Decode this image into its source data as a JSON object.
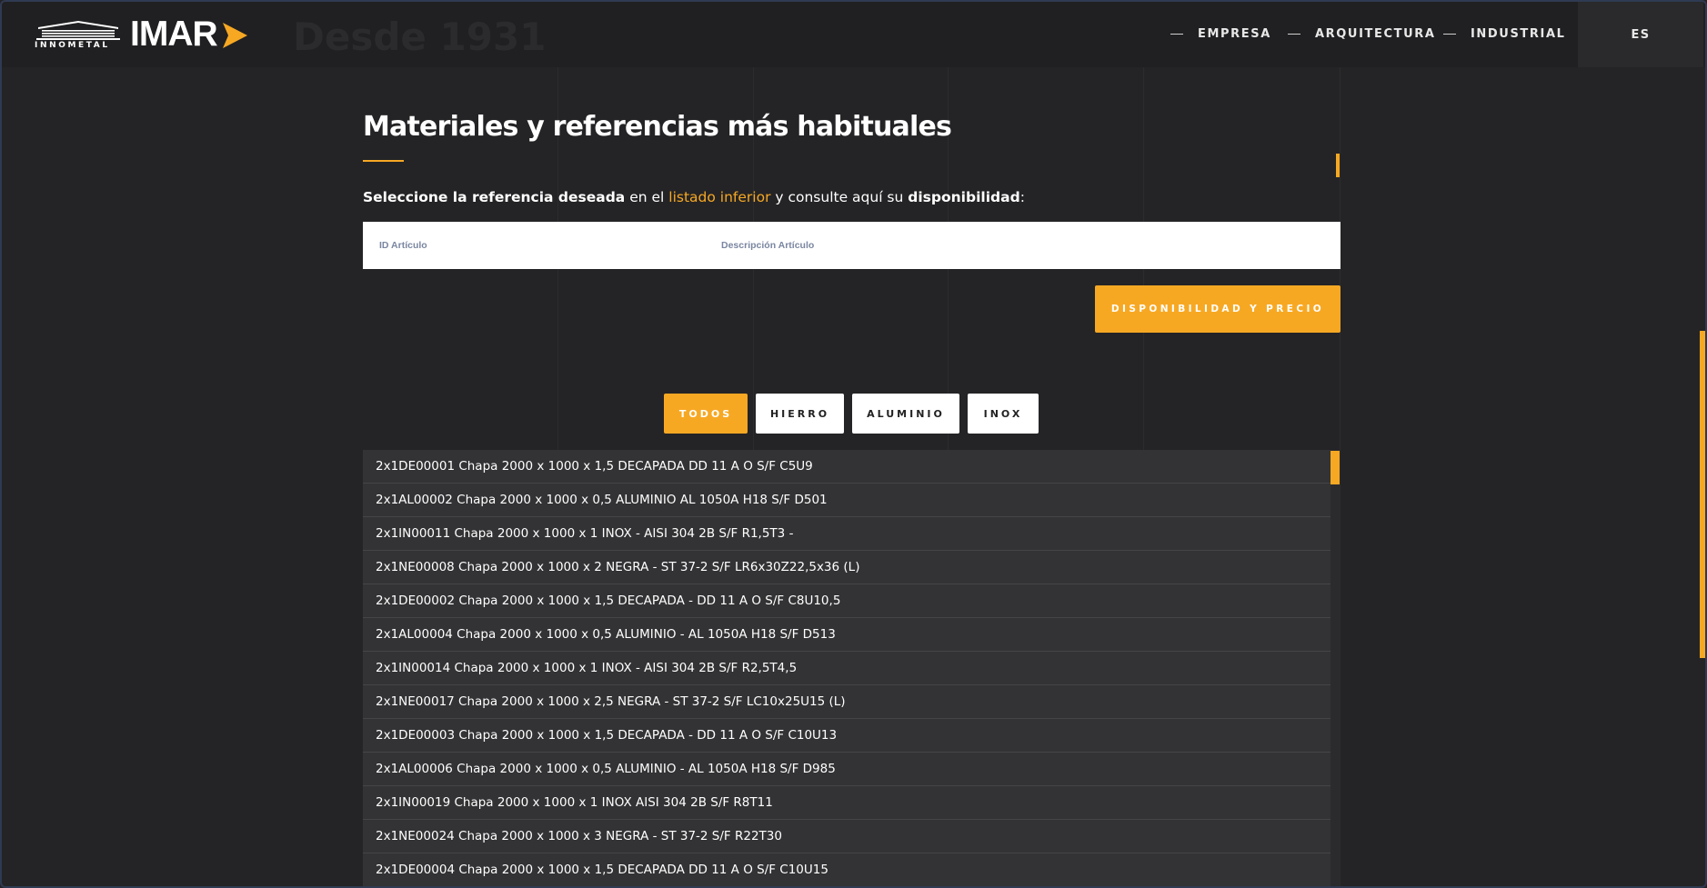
{
  "header": {
    "logo_innometal": "INNOMETAL",
    "logo_imar": "IMAR",
    "since": "Desde 1931",
    "nav": [
      {
        "label": "EMPRESA"
      },
      {
        "label": "ARQUITECTURA"
      },
      {
        "label": "INDUSTRIAL"
      }
    ],
    "language": "ES"
  },
  "main": {
    "title": "Materiales y referencias más habituales",
    "instruction": {
      "part1": "Seleccione la referencia deseada",
      "part2": " en el ",
      "part3": "listado inferior",
      "part4": " y consulte aquí su ",
      "part5": "disponibilidad",
      "part6": ":"
    },
    "search": {
      "id_placeholder": "ID Artículo",
      "desc_placeholder": "Descripción Artículo"
    },
    "price_button": "DISPONIBILIDAD Y PRECIO",
    "filters": [
      {
        "label": "TODOS",
        "active": true
      },
      {
        "label": "HIERRO",
        "active": false
      },
      {
        "label": "ALUMINIO",
        "active": false
      },
      {
        "label": "INOX",
        "active": false
      }
    ],
    "items": [
      "2x1DE00001 Chapa 2000 x 1000 x 1,5 DECAPADA DD 11 A O S/F C5U9",
      "2x1AL00002 Chapa 2000 x 1000 x 0,5 ALUMINIO AL 1050A H18 S/F D501",
      "2x1IN00011 Chapa 2000 x 1000 x 1 INOX - AISI 304 2B S/F R1,5T3 -",
      "2x1NE00008 Chapa 2000 x 1000 x 2 NEGRA - ST 37-2 S/F LR6x30Z22,5x36 (L)",
      "2x1DE00002 Chapa 2000 x 1000 x 1,5 DECAPADA - DD 11 A O S/F C8U10,5",
      "2x1AL00004 Chapa 2000 x 1000 x 0,5 ALUMINIO - AL 1050A H18 S/F D513",
      "2x1IN00014 Chapa 2000 x 1000 x 1 INOX - AISI 304 2B S/F R2,5T4,5",
      "2x1NE00017 Chapa 2000 x 1000 x 2,5 NEGRA - ST 37-2 S/F LC10x25U15 (L)",
      "2x1DE00003 Chapa 2000 x 1000 x 1,5 DECAPADA - DD 11 A O S/F C10U13",
      "2x1AL00006 Chapa 2000 x 1000 x 0,5 ALUMINIO - AL 1050A H18 S/F D985",
      "2x1IN00019 Chapa 2000 x 1000 x 1 INOX AISI 304 2B S/F R8T11",
      "2x1NE00024 Chapa 2000 x 1000 x 3 NEGRA - ST 37-2 S/F R22T30",
      "2x1DE00004 Chapa 2000 x 1000 x 1,5 DECAPADA DD 11 A O S/F C10U15"
    ]
  },
  "colors": {
    "accent": "#f7a823",
    "background": "#242426",
    "row": "#333335"
  }
}
